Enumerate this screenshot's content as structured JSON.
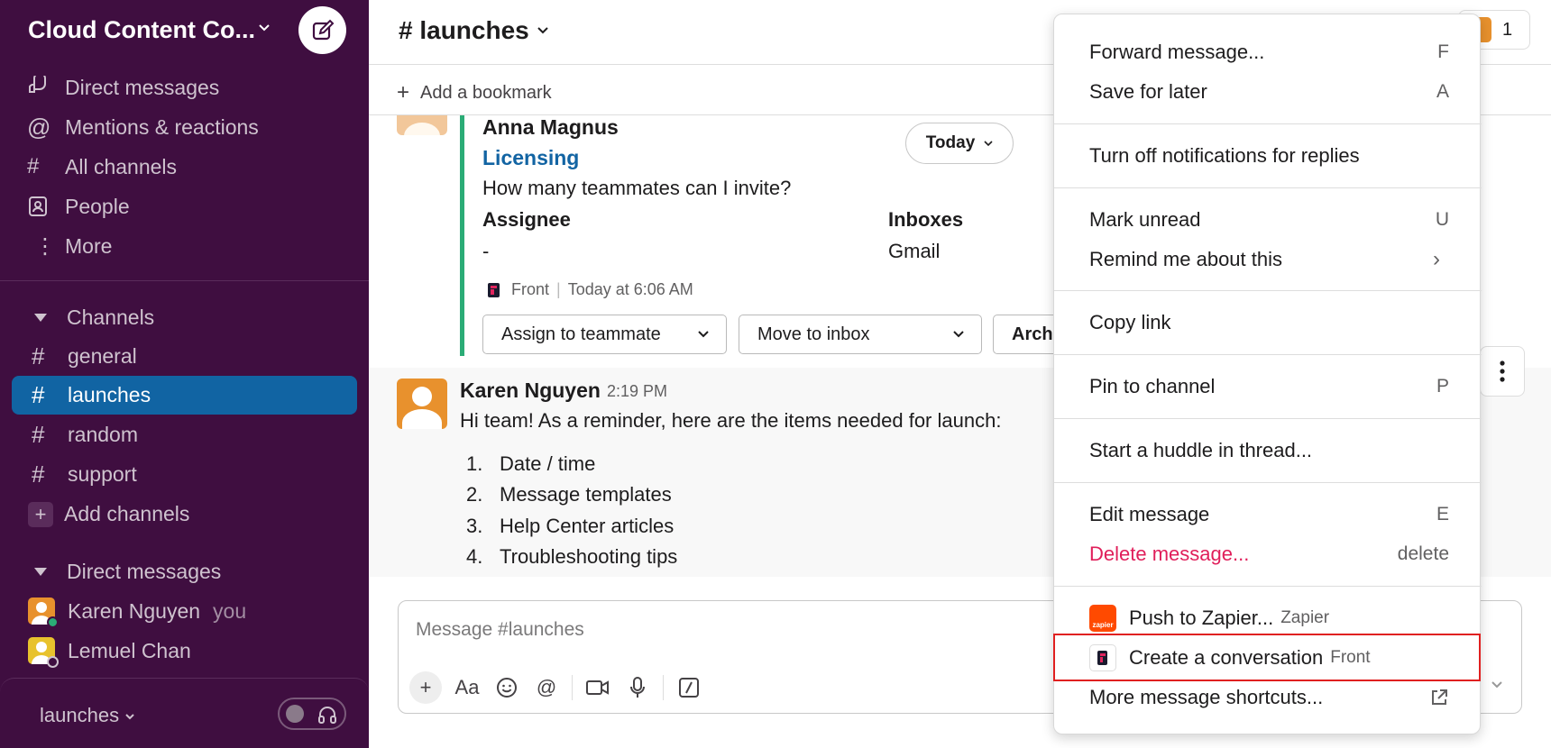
{
  "workspace": {
    "name": "Cloud Content Co...",
    "compose_icon": "compose-icon"
  },
  "nav": [
    {
      "label": "Direct messages",
      "icon": "dm-icon"
    },
    {
      "label": "Mentions & reactions",
      "icon": "at-icon"
    },
    {
      "label": "All channels",
      "icon": "channel-search-icon"
    },
    {
      "label": "People",
      "icon": "people-icon"
    },
    {
      "label": "More",
      "icon": "more-vertical-icon"
    }
  ],
  "channels": {
    "header": "Channels",
    "items": [
      "general",
      "launches",
      "random",
      "support"
    ],
    "active": "launches",
    "add_label": "Add channels"
  },
  "dms": {
    "header": "Direct messages",
    "items": [
      {
        "name": "Karen Nguyen",
        "suffix": "you",
        "status": "#2bac76",
        "color": "#e8912d"
      },
      {
        "name": "Lemuel Chan",
        "suffix": "",
        "status": "#ffffff",
        "color": "#e8c22d"
      }
    ]
  },
  "footer": {
    "channel": "launches"
  },
  "header": {
    "channel_title": "# launches",
    "member_count": "1"
  },
  "bookmark": {
    "label": "Add a bookmark"
  },
  "front_card": {
    "name": "Anna Magnus",
    "link": "Licensing",
    "question": "How many teammates can I invite?",
    "assignee_label": "Assignee",
    "assignee_value": "-",
    "inboxes_label": "Inboxes",
    "inboxes_value": "Gmail",
    "meta_app": "Front",
    "meta_time": "Today at 6:06 AM",
    "assign_btn": "Assign to teammate",
    "move_btn": "Move to inbox",
    "archive_btn": "Archi",
    "today_label": "Today"
  },
  "message": {
    "author": "Karen Nguyen",
    "time": "2:19 PM",
    "text": "Hi team! As a reminder, here are the items needed for launch:",
    "list": [
      {
        "num": "1.",
        "text": "Date / time"
      },
      {
        "num": "2.",
        "text": "Message templates"
      },
      {
        "num": "3.",
        "text": "Help Center articles"
      },
      {
        "num": "4.",
        "text": "Troubleshooting tips"
      }
    ]
  },
  "composer": {
    "placeholder": "Message #launches"
  },
  "menu": {
    "forward": {
      "label": "Forward message...",
      "shortcut": "F"
    },
    "save": {
      "label": "Save for later",
      "shortcut": "A"
    },
    "notifications": {
      "label": "Turn off notifications for replies"
    },
    "unread": {
      "label": "Mark unread",
      "shortcut": "U"
    },
    "remind": {
      "label": "Remind me about this",
      "shortcut": "›"
    },
    "copy": {
      "label": "Copy link"
    },
    "pin": {
      "label": "Pin to channel",
      "shortcut": "P"
    },
    "huddle": {
      "label": "Start a huddle in thread..."
    },
    "edit": {
      "label": "Edit message",
      "shortcut": "E"
    },
    "delete": {
      "label": "Delete message...",
      "shortcut": "delete"
    },
    "zapier": {
      "label": "Push to Zapier...",
      "app": "Zapier",
      "icon_text": "zapier"
    },
    "front": {
      "label": "Create a conversation",
      "app": "Front"
    },
    "shortcuts": {
      "label": "More message shortcuts..."
    }
  },
  "colors": {
    "sidebar_bg": "#3f0e40",
    "active_channel": "#1164a3",
    "link": "#1264a3",
    "danger": "#e01e5a",
    "front_accent": "#2bac76",
    "highlight": "#e02020"
  }
}
